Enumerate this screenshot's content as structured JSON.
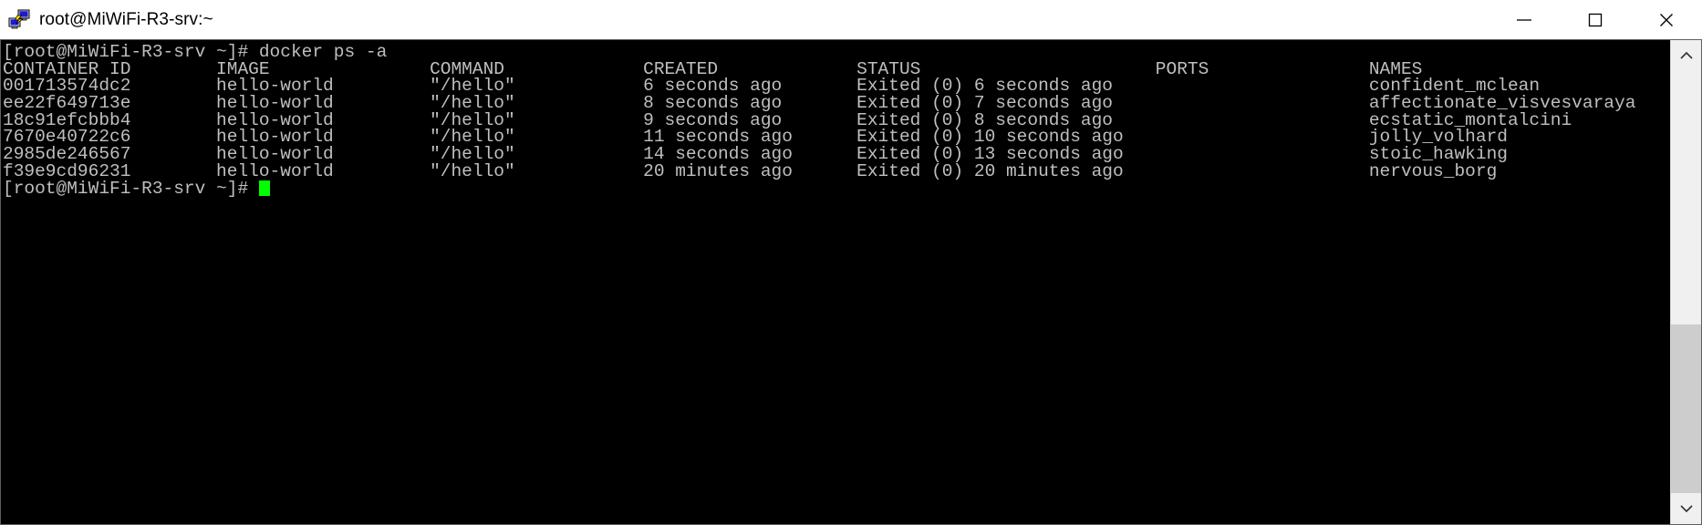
{
  "window": {
    "title": "root@MiWiFi-R3-srv:~",
    "icon": "putty-network-computer-icon",
    "controls": {
      "minimize_label": "Minimize",
      "maximize_label": "Maximize",
      "close_label": "Close"
    }
  },
  "terminal": {
    "colors": {
      "background": "#000000",
      "foreground": "#bfbfbf",
      "cursor": "#00ff00"
    },
    "prompt": "[root@MiWiFi-R3-srv ~]#",
    "command": "docker ps -a",
    "command_line": "[root@MiWiFi-R3-srv ~]# docker ps -a",
    "header_line": "CONTAINER ID        IMAGE               COMMAND             CREATED             STATUS                      PORTS               NAMES",
    "rows": [
      "001713574dc2        hello-world         \"/hello\"            6 seconds ago       Exited (0) 6 seconds ago                        confident_mclean",
      "ee22f649713e        hello-world         \"/hello\"            8 seconds ago       Exited (0) 7 seconds ago                        affectionate_visvesvaraya",
      "18c91efcbbb4        hello-world         \"/hello\"            9 seconds ago       Exited (0) 8 seconds ago                        ecstatic_montalcini",
      "7670e40722c6        hello-world         \"/hello\"            11 seconds ago      Exited (0) 10 seconds ago                       jolly_volhard",
      "2985de246567        hello-world         \"/hello\"            14 seconds ago      Exited (0) 13 seconds ago                       stoic_hawking",
      "f39e9cd96231        hello-world         \"/hello\"            20 minutes ago      Exited (0) 20 minutes ago                       nervous_borg"
    ],
    "final_prompt_line": "[root@MiWiFi-R3-srv ~]# ",
    "table": {
      "columns": [
        "CONTAINER ID",
        "IMAGE",
        "COMMAND",
        "CREATED",
        "STATUS",
        "PORTS",
        "NAMES"
      ],
      "records": [
        {
          "container_id": "001713574dc2",
          "image": "hello-world",
          "command": "\"/hello\"",
          "created": "6 seconds ago",
          "status": "Exited (0) 6 seconds ago",
          "ports": "",
          "names": "confident_mclean"
        },
        {
          "container_id": "ee22f649713e",
          "image": "hello-world",
          "command": "\"/hello\"",
          "created": "8 seconds ago",
          "status": "Exited (0) 7 seconds ago",
          "ports": "",
          "names": "affectionate_visvesvaraya"
        },
        {
          "container_id": "18c91efcbbb4",
          "image": "hello-world",
          "command": "\"/hello\"",
          "created": "9 seconds ago",
          "status": "Exited (0) 8 seconds ago",
          "ports": "",
          "names": "ecstatic_montalcini"
        },
        {
          "container_id": "7670e40722c6",
          "image": "hello-world",
          "command": "\"/hello\"",
          "created": "11 seconds ago",
          "status": "Exited (0) 10 seconds ago",
          "ports": "",
          "names": "jolly_volhard"
        },
        {
          "container_id": "2985de246567",
          "image": "hello-world",
          "command": "\"/hello\"",
          "created": "14 seconds ago",
          "status": "Exited (0) 13 seconds ago",
          "ports": "",
          "names": "stoic_hawking"
        },
        {
          "container_id": "f39e9cd96231",
          "image": "hello-world",
          "command": "\"/hello\"",
          "created": "20 minutes ago",
          "status": "Exited (0) 20 minutes ago",
          "ports": "",
          "names": "nervous_borg"
        }
      ]
    }
  },
  "scrollbar": {
    "up_arrow": "chevron-up-icon",
    "down_arrow": "chevron-down-icon"
  }
}
